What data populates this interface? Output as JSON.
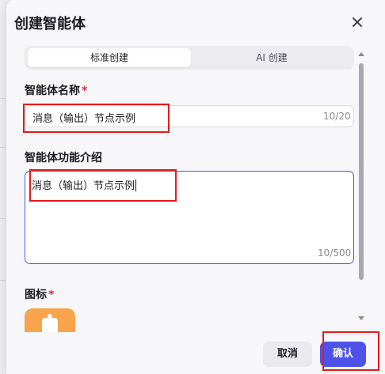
{
  "dialog": {
    "title": "创建智能体"
  },
  "mode_tabs": [
    {
      "label": "标准创建",
      "active": true
    },
    {
      "label": "AI 创建",
      "active": false
    }
  ],
  "name_field": {
    "label": "智能体名称",
    "required_mark": "*",
    "value": "消息（输出）节点示例",
    "counter": "10/20"
  },
  "description_field": {
    "label": "智能体功能介绍",
    "value": "消息（输出）节点示例",
    "counter": "10/500"
  },
  "icon_field": {
    "label": "图标",
    "required_mark": "*"
  },
  "buttons": {
    "cancel": "取消",
    "confirm": "确认"
  },
  "colors": {
    "accent": "#4d53e8",
    "required": "#f5222d",
    "icon_bg": "#f7a44c",
    "annotation": "#e41b1b"
  }
}
